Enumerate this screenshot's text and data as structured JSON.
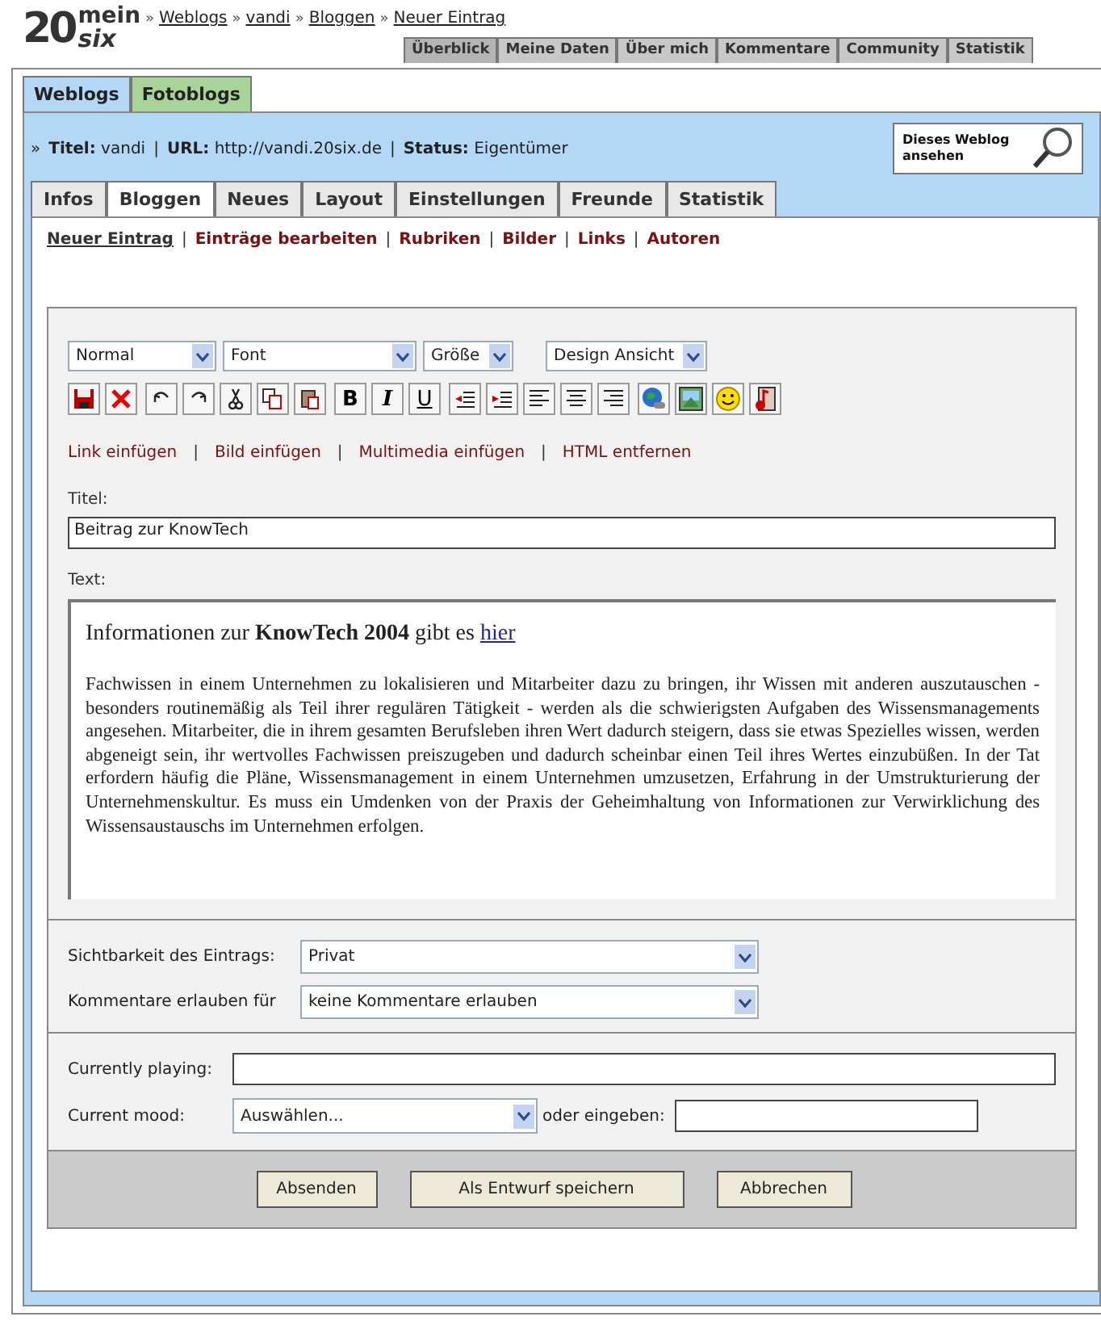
{
  "logo": {
    "number": "20",
    "top": "mein",
    "bottom": "six"
  },
  "breadcrumb": {
    "separator": "»",
    "items": [
      "Weblogs",
      "vandi",
      "Bloggen",
      "Neuer Eintrag"
    ]
  },
  "top_nav": [
    {
      "label": "Überblick",
      "selected": true
    },
    {
      "label": "Meine Daten",
      "selected": false
    },
    {
      "label": "Über mich",
      "selected": false
    },
    {
      "label": "Kommentare",
      "selected": false
    },
    {
      "label": "Community",
      "selected": false
    },
    {
      "label": "Statistik",
      "selected": false
    }
  ],
  "section_tabs": [
    {
      "label": "Weblogs",
      "selected": true
    },
    {
      "label": "Fotoblogs",
      "selected": false
    }
  ],
  "info": {
    "prefix": "»",
    "separator": "|",
    "fields": [
      {
        "label": "Titel:",
        "value": "vandi"
      },
      {
        "label": "URL:",
        "value": "http://vandi.20six.de"
      },
      {
        "label": "Status:",
        "value": "Eigentümer"
      }
    ]
  },
  "view_blog_button": "Dieses Weblog ansehen",
  "tabs": [
    {
      "label": "Infos",
      "selected": false
    },
    {
      "label": "Bloggen",
      "selected": true
    },
    {
      "label": "Neues",
      "selected": false
    },
    {
      "label": "Layout",
      "selected": false
    },
    {
      "label": "Einstellungen",
      "selected": false
    },
    {
      "label": "Freunde",
      "selected": false
    },
    {
      "label": "Statistik",
      "selected": false
    }
  ],
  "sub_nav": {
    "separator": "|",
    "items": [
      {
        "label": "Neuer Eintrag",
        "selected": true
      },
      {
        "label": "Einträge bearbeiten",
        "selected": false
      },
      {
        "label": "Rubriken",
        "selected": false
      },
      {
        "label": "Bilder",
        "selected": false
      },
      {
        "label": "Links",
        "selected": false
      },
      {
        "label": "Autoren",
        "selected": false
      }
    ]
  },
  "editor_selects": [
    "Normal",
    "Font",
    "Größe",
    "Design Ansicht"
  ],
  "format_buttons": [
    "B",
    "I",
    "U"
  ],
  "insert_links": {
    "separator": "|",
    "items": [
      "Link einfügen",
      "Bild einfügen",
      "Multimedia einfügen",
      "HTML entfernen"
    ]
  },
  "title_field": {
    "label": "Titel:",
    "value": "Beitrag zur KnowTech"
  },
  "text_field": {
    "label": "Text:",
    "heading": "Informationen zur **KnowTech 2004** gibt es",
    "heading_link": "hier",
    "paragraph": "Fachwissen in einem Unternehmen zu lokalisieren und Mitarbeiter dazu zu bringen, ihr Wissen mit anderen auszutauschen - besonders routinemäßig als Teil ihrer regulären Tätigkeit - werden als die schwierigsten Aufgaben des Wissensmanagements angesehen. Mitarbeiter, die in ihrem gesamten Berufsleben ihren Wert dadurch steigern, dass sie etwas Spezielles wissen, werden abgeneigt sein, ihr wertvolles Fachwissen preiszugeben und dadurch scheinbar einen Teil ihres Wertes einzubüßen. In der Tat erfordern häufig die Pläne, Wissensmanagement in einem Unternehmen umzusetzen, Erfahrung in der Umstrukturierung der Unternehmenskultur. Es muss ein Umdenken von der Praxis der Geheimhaltung von Informationen zur Verwirklichung des Wissensaustauschs im Unternehmen erfolgen."
  },
  "settings": [
    {
      "label": "Sichtbarkeit des Eintrags:",
      "value": "Privat"
    },
    {
      "label": "Kommentare erlauben für",
      "value": "keine Kommentare erlauben"
    }
  ],
  "currently_playing": {
    "label": "Currently playing:"
  },
  "mood": {
    "label": "Current mood:",
    "value": "Auswählen...",
    "or_label": "oder eingeben:"
  },
  "buttons": [
    "Absenden",
    "Als Entwurf speichern",
    "Abbrechen"
  ]
}
